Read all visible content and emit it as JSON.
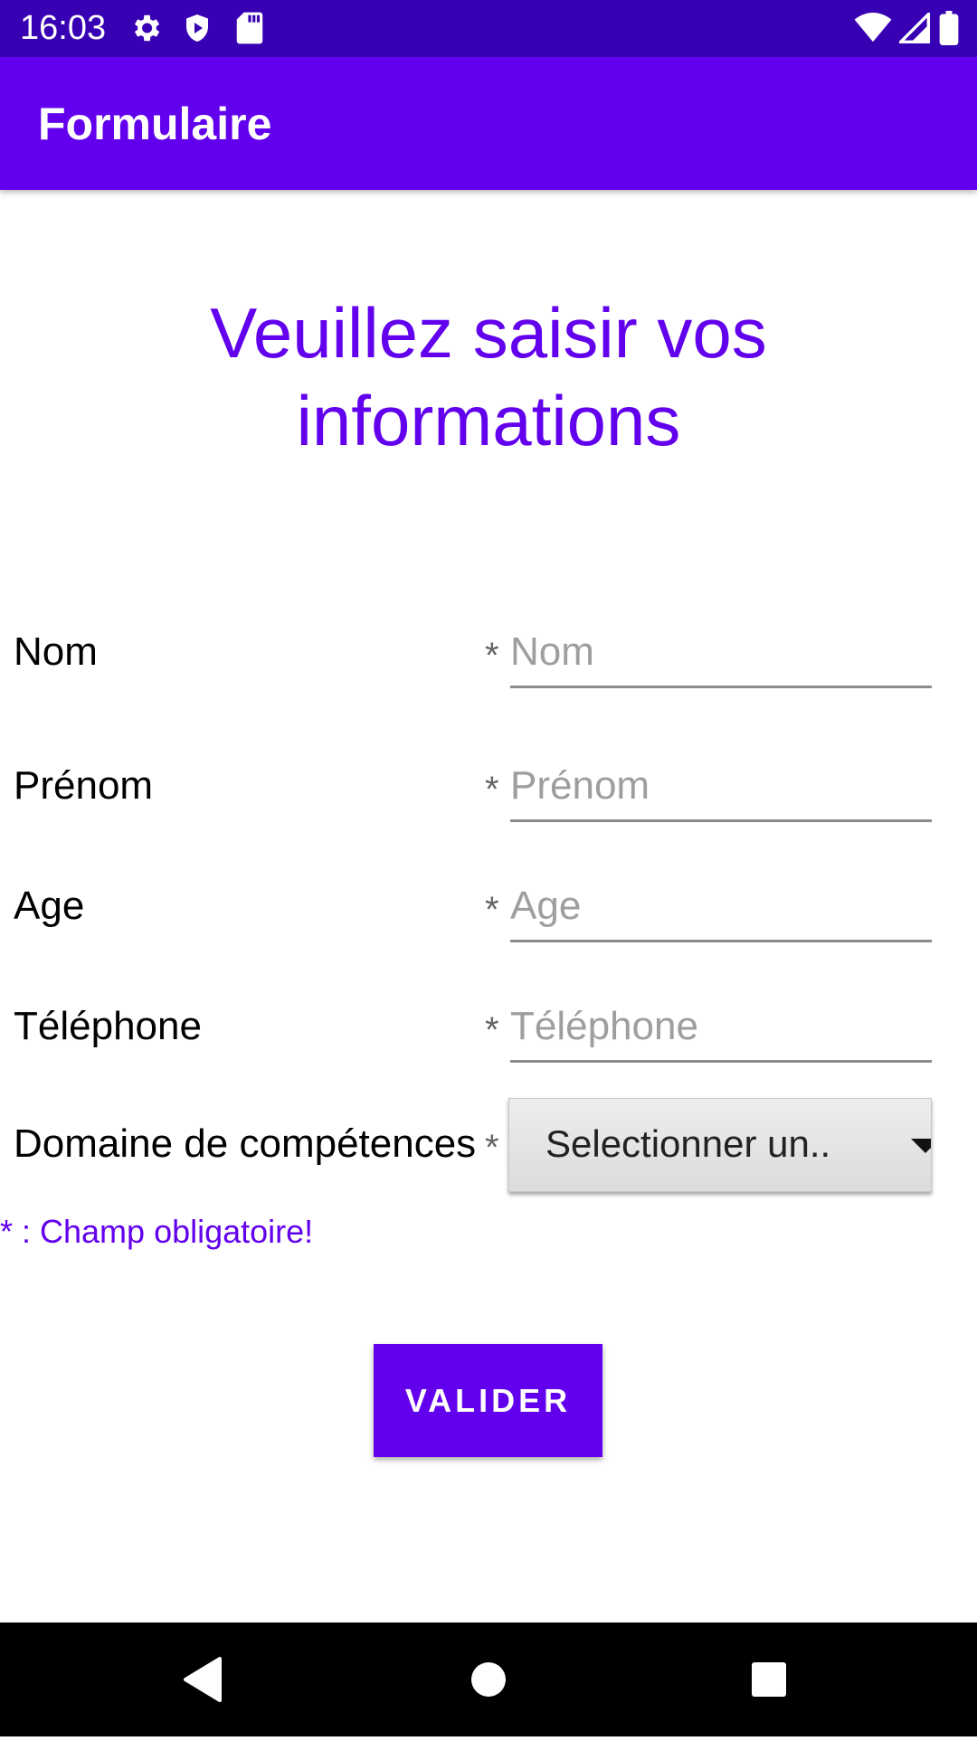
{
  "status_bar": {
    "time": "16:03",
    "left_icons": [
      "gear-icon",
      "shield-icon",
      "sd-card-icon"
    ],
    "right_icons": [
      "wifi-icon",
      "signal-icon",
      "battery-icon"
    ]
  },
  "app_bar": {
    "title": "Formulaire"
  },
  "heading": "Veuillez saisir vos informations",
  "form": {
    "rows": [
      {
        "label": "Nom",
        "star": "*",
        "placeholder": "Nom",
        "value": ""
      },
      {
        "label": "Prénom",
        "star": "*",
        "placeholder": "Prénom",
        "value": ""
      },
      {
        "label": "Age",
        "star": "*",
        "placeholder": "Age",
        "value": ""
      },
      {
        "label": "Téléphone",
        "star": "*",
        "placeholder": "Téléphone",
        "value": ""
      }
    ],
    "domain": {
      "label": "Domaine de compétences",
      "star": "*",
      "selected": "Selectionner un.."
    },
    "note": "* : Champ obligatoire!",
    "submit_label": "VALIDER"
  },
  "nav_bar": {
    "buttons": [
      "back-icon",
      "home-icon",
      "recents-icon"
    ]
  },
  "colors": {
    "primary": "#6200ee",
    "primary_dark": "#3700b3"
  }
}
